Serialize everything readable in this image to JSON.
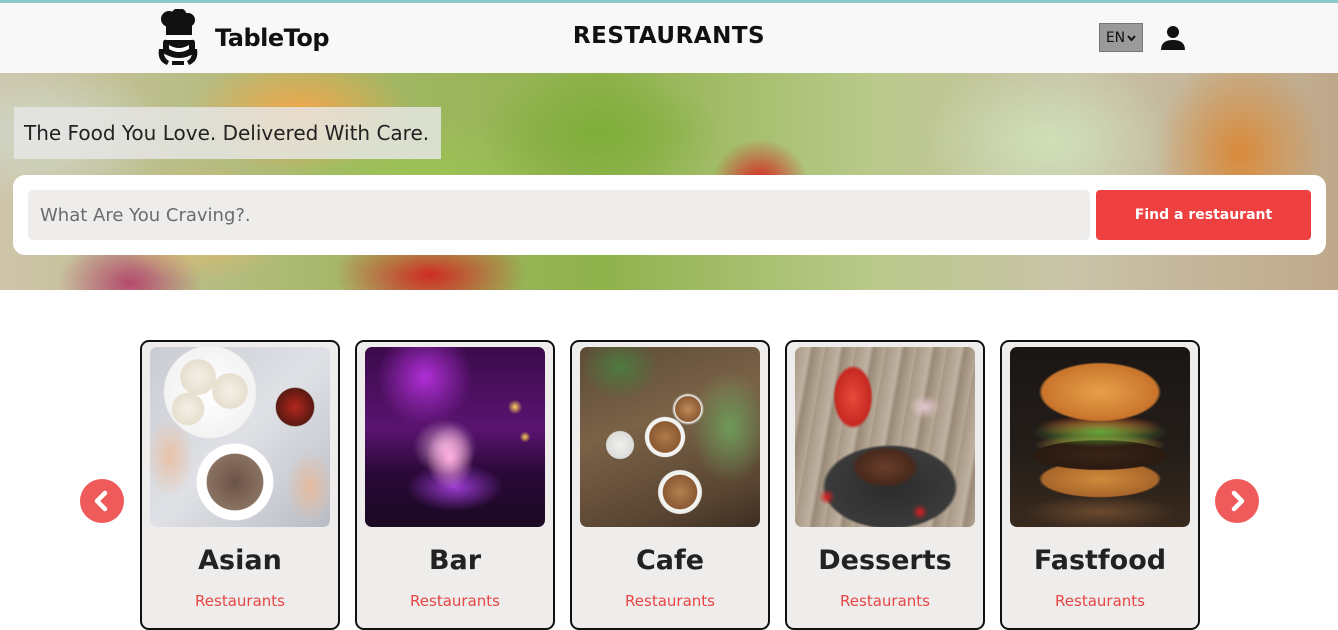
{
  "header": {
    "brand": "TableTop",
    "page_title": "RESTAURANTS",
    "language": "EN"
  },
  "hero": {
    "tagline": "The Food You Love. Delivered With Care.",
    "search_placeholder": "What Are You Craving?.",
    "search_value": "",
    "find_button": "Find a restaurant"
  },
  "categories": [
    {
      "name": "Asian",
      "subtitle": "Restaurants"
    },
    {
      "name": "Bar",
      "subtitle": "Restaurants"
    },
    {
      "name": "Cafe",
      "subtitle": "Restaurants"
    },
    {
      "name": "Desserts",
      "subtitle": "Restaurants"
    },
    {
      "name": "Fastfood",
      "subtitle": "Restaurants"
    }
  ],
  "icons": {
    "logo": "chef-hat-icon",
    "user": "user-icon",
    "prev": "chevron-left-icon",
    "next": "chevron-right-icon",
    "dropdown": "chevron-down-icon"
  },
  "colors": {
    "accent": "#ee4040",
    "arrow": "#ef5a5a",
    "card_bg": "#eeedeb"
  }
}
